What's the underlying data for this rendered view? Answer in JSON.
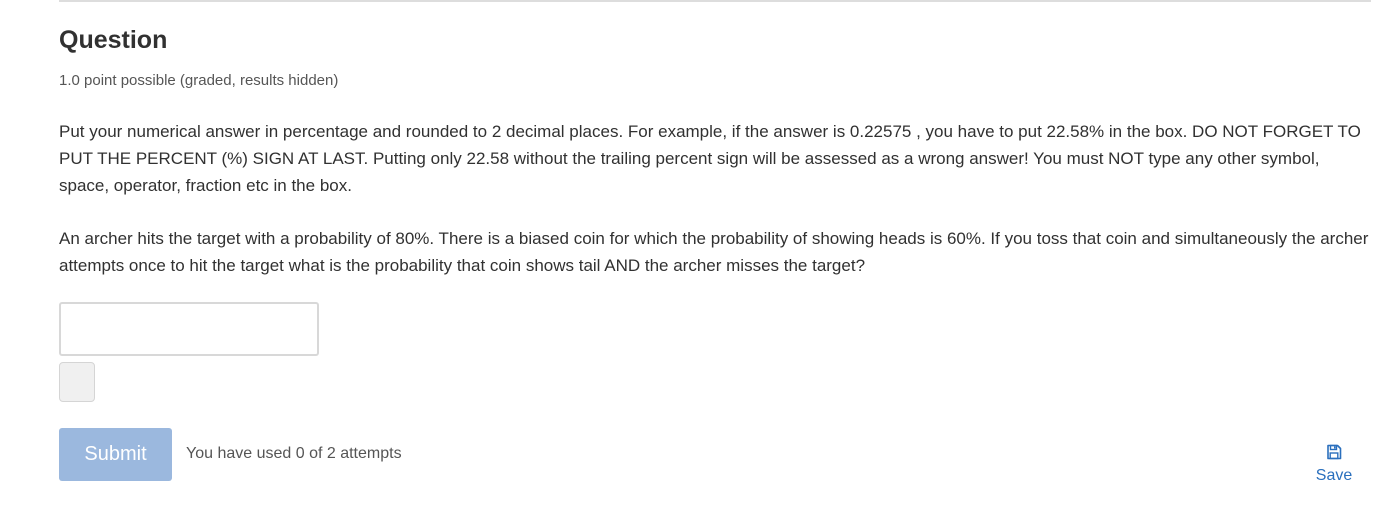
{
  "question": {
    "title": "Question",
    "points": "1.0 point possible (graded, results hidden)",
    "instructions": "Put your numerical answer in percentage and rounded to 2 decimal places. For example, if the answer is 0.22575 , you have to put 22.58% in the box. DO NOT FORGET TO PUT THE PERCENT (%) SIGN AT LAST. Putting only 22.58 without the trailing percent sign will be assessed as a wrong answer! You must NOT type any other symbol, space, operator, fraction etc in the box.",
    "problem": "An archer hits the target with a probability of 80%. There is a biased coin for which the probability of showing heads is 60%. If you toss that coin and simultaneously the archer attempts once to hit the target what is the probability that coin shows tail AND the archer misses the target?"
  },
  "answer": {
    "value": "",
    "placeholder": ""
  },
  "actions": {
    "submit_label": "Submit",
    "attempts_text": "You have used 0 of 2 attempts",
    "save_label": "Save",
    "save_icon": "floppy-disk-icon"
  },
  "colors": {
    "submit_bg": "#9bb8de",
    "link": "#2a6fbd"
  }
}
